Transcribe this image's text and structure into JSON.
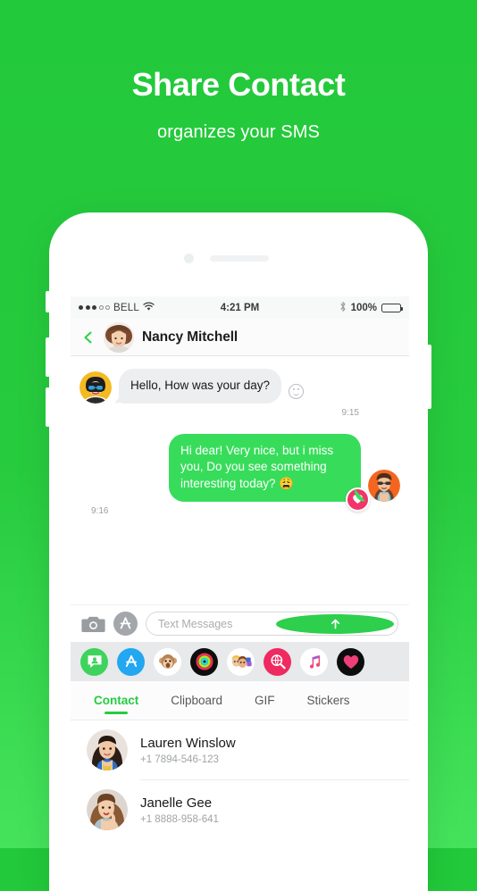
{
  "hero": {
    "title": "Share Contact",
    "subtitle": "organizes your SMS"
  },
  "colors": {
    "brand_green": "#22c93a",
    "bubble_green": "#37dd5a",
    "accent_green": "#25cc42",
    "heart_red": "#f4336a",
    "bubble_grey": "#eceef0"
  },
  "status_bar": {
    "carrier": "BELL",
    "signal_filled": 3,
    "signal_total": 5,
    "wifi_icon": "wifi-icon",
    "time": "4:21 PM",
    "bluetooth_icon": "bluetooth-icon",
    "battery_percent": "100%",
    "battery_level": 100
  },
  "nav": {
    "back_icon": "back-chevron-icon",
    "avatar": "nancy-avatar",
    "title": "Nancy Mitchell"
  },
  "conversation": {
    "messages": [
      {
        "direction": "in",
        "text": "Hello, How was your day?",
        "time": "9:15",
        "avatar": "incoming-avatar",
        "trailing_icon": "smiley-icon"
      },
      {
        "direction": "out",
        "text": "Hi dear! Very nice, but i miss you, Do you see something interesting today? 😩",
        "time": "9:16",
        "avatar": "outgoing-avatar",
        "reaction": "heart-badge-icon"
      }
    ]
  },
  "input_bar": {
    "camera_icon": "camera-icon",
    "appstore_icon": "app-store-icon",
    "placeholder": "Text Messages",
    "value": "",
    "send_icon": "send-arrow-up-icon"
  },
  "app_strip": {
    "items": [
      {
        "name": "messages-app-icon",
        "label": "Messages"
      },
      {
        "name": "app-store-app-icon",
        "label": "App Store"
      },
      {
        "name": "animoji-monkey-icon",
        "label": "Animoji"
      },
      {
        "name": "activity-rings-icon",
        "label": "Activity"
      },
      {
        "name": "memoji-people-icon",
        "label": "Memoji"
      },
      {
        "name": "image-search-icon",
        "label": "#images"
      },
      {
        "name": "music-note-icon",
        "label": "Music"
      },
      {
        "name": "heart-digital-touch-icon",
        "label": "Digital Touch"
      }
    ]
  },
  "tabs": {
    "items": [
      {
        "label": "Contact",
        "active": true
      },
      {
        "label": "Clipboard",
        "active": false
      },
      {
        "label": "GIF",
        "active": false
      },
      {
        "label": "Stickers",
        "active": false
      }
    ]
  },
  "contacts": {
    "rows": [
      {
        "name": "Lauren Winslow",
        "phone": "+1 7894-546-123",
        "avatar": "lauren-avatar"
      },
      {
        "name": "Janelle Gee",
        "phone": "+1 8888-958-641",
        "avatar": "janelle-avatar"
      }
    ]
  }
}
